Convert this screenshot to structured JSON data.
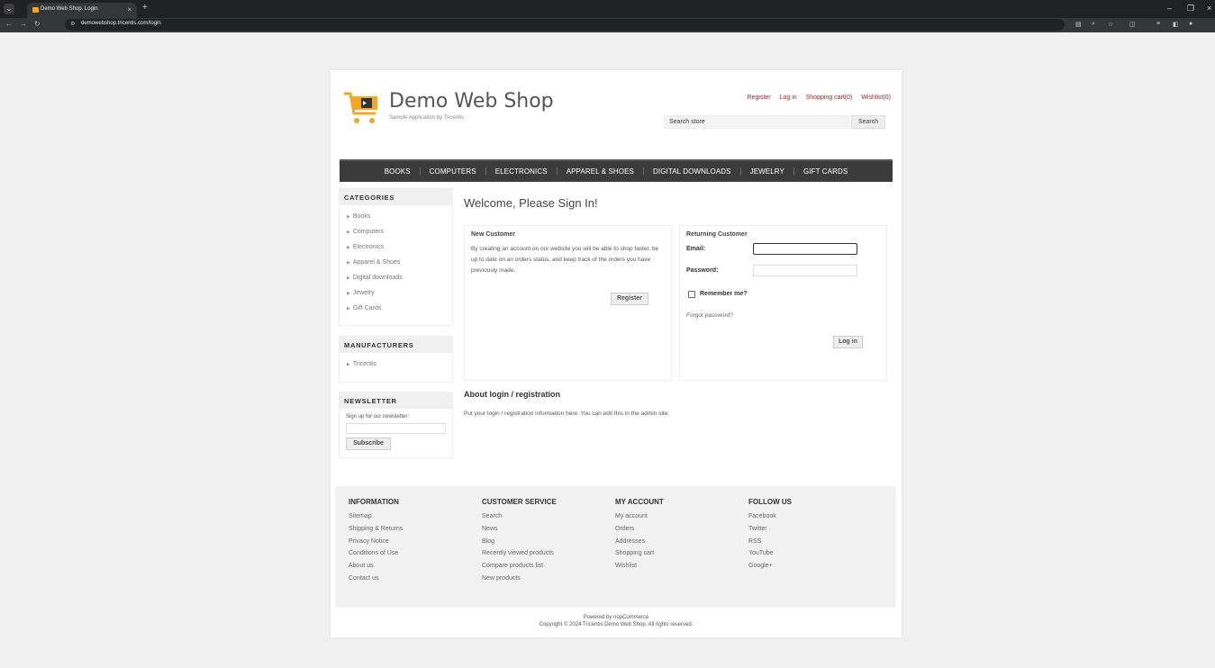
{
  "browser": {
    "tab_title": "Demo Web Shop. Login",
    "tab_close": "×",
    "new_tab": "+",
    "url": "demowebshop.tricentis.com/login"
  },
  "header": {
    "logo_title": "Demo Web Shop",
    "logo_subtitle": "Sample Application by Tricentis",
    "links": [
      "Register",
      "Log in",
      "Shopping cart(0)",
      "Wishlist(0)"
    ],
    "search_value": "Search store",
    "search_button": "Search"
  },
  "menu": [
    "BOOKS",
    "COMPUTERS",
    "ELECTRONICS",
    "APPAREL & SHOES",
    "DIGITAL DOWNLOADS",
    "JEWELRY",
    "GIFT CARDS"
  ],
  "sidebar": {
    "categories_title": "CATEGORIES",
    "categories": [
      "Books",
      "Computers",
      "Electronics",
      "Apparel & Shoes",
      "Digital downloads",
      "Jewelry",
      "Gift Cards"
    ],
    "manufacturers_title": "MANUFACTURERS",
    "manufacturers": [
      "Tricentis"
    ],
    "newsletter_title": "NEWSLETTER",
    "newsletter_text": "Sign up for our newsletter:",
    "subscribe": "Subscribe"
  },
  "main": {
    "welcome": "Welcome, Please Sign In!",
    "new_customer": {
      "title": "New Customer",
      "text": "By creating an account on our website you will be able to shop faster, be up to date on an orders status, and keep track of the orders you have previously made.",
      "register": "Register"
    },
    "returning": {
      "title": "Returning Customer",
      "email_label": "Email:",
      "password_label": "Password:",
      "remember": "Remember me?",
      "forgot": "Forgot password?",
      "login": "Log in"
    },
    "about_title": "About login / registration",
    "about_text": "Put your login / registration information here. You can edit this in the admin site."
  },
  "footer": {
    "columns": [
      {
        "title": "INFORMATION",
        "items": [
          "Sitemap",
          "Shipping & Returns",
          "Privacy Notice",
          "Conditions of Use",
          "About us",
          "Contact us"
        ]
      },
      {
        "title": "CUSTOMER SERVICE",
        "items": [
          "Search",
          "News",
          "Blog",
          "Recently viewed products",
          "Compare products list",
          "New products"
        ]
      },
      {
        "title": "MY ACCOUNT",
        "items": [
          "My account",
          "Orders",
          "Addresses",
          "Shopping cart",
          "Wishlist"
        ]
      },
      {
        "title": "FOLLOW US",
        "items": [
          "Facebook",
          "Twitter",
          "RSS",
          "YouTube",
          "Google+"
        ]
      }
    ],
    "powered": "Powered by nopCommerce",
    "copyright": "Copyright © 2024 Tricentis Demo Web Shop. All rights reserved."
  },
  "colors": {
    "link_red": "#a0252a",
    "menu_bg": "#3b3b3b",
    "cart_orange": "#f5a623"
  }
}
